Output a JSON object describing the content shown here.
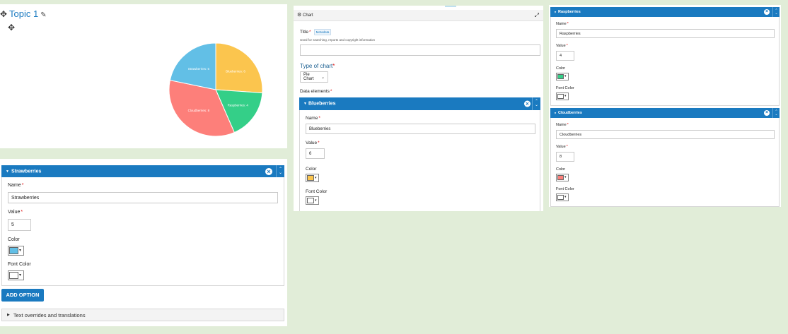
{
  "topic": {
    "title": "Topic 1",
    "move_glyph": "✥",
    "edit_glyph": "✎"
  },
  "chart_data": {
    "type": "pie",
    "title": "",
    "slices": [
      {
        "label": "Raspberries: 4",
        "value": 4,
        "color": "#fbc54e"
      },
      {
        "label": "Blueberries: 6",
        "value": 6,
        "color": "#fbc54e"
      },
      {
        "label": "Cloudberries: 8",
        "value": 8,
        "color": "#fd8c80"
      },
      {
        "label": "Strawberries: 5",
        "value": 5,
        "color": "#62bfe6"
      }
    ],
    "rendered_slices": [
      {
        "label": "Blueberries: 6",
        "value": 6,
        "color": "#fbc54e"
      },
      {
        "label": "Raspberries: 4",
        "value": 4,
        "color": "#34cf88"
      },
      {
        "label": "Cloudberries: 8",
        "value": 8,
        "color": "#fd7f7a"
      },
      {
        "label": "Strawberries: 5",
        "value": 5,
        "color": "#62bfe6"
      }
    ],
    "label_color": "#ffffff"
  },
  "chart_editor": {
    "header_icon": "chart-icon",
    "header_label": "Chart",
    "expand_glyph": "⤢",
    "title_label": "Title",
    "metadata_badge": "Metadata",
    "title_desc": "Used for searching, reports and copyright information",
    "title_value": "",
    "type_label": "Type of chart",
    "type_value": "Pie Chart",
    "data_elements_label": "Data elements"
  },
  "fields": {
    "name_label": "Name",
    "value_label": "Value",
    "color_label": "Color",
    "font_color_label": "Font Color",
    "required_mark": "*",
    "close_glyph": "×",
    "expand_tri": "▼",
    "collapsed_tri": "▶",
    "up_glyph": "⌃",
    "down_glyph": "⌄",
    "swatch_arrow": "▾"
  },
  "elements": {
    "blueberries": {
      "name": "Blueberries",
      "value": "6",
      "color": "#fbc54e",
      "font_color": "#ffffff"
    },
    "raspberries": {
      "name": "Raspberries",
      "value": "4",
      "color": "#34cf88",
      "font_color": "#ffffff"
    },
    "cloudberries": {
      "name": "Cloudberries",
      "value": "8",
      "color": "#fd7f7a",
      "font_color": "#ffffff"
    },
    "strawberries": {
      "name": "Strawberries",
      "value": "5",
      "color": "#62bfe6",
      "font_color": "#ffffff"
    }
  },
  "add_option_label": "ADD OPTION",
  "overrides_label": "Text overrides and translations",
  "colors": {
    "accent": "#1a7ac0",
    "background": "#e1edd8"
  }
}
